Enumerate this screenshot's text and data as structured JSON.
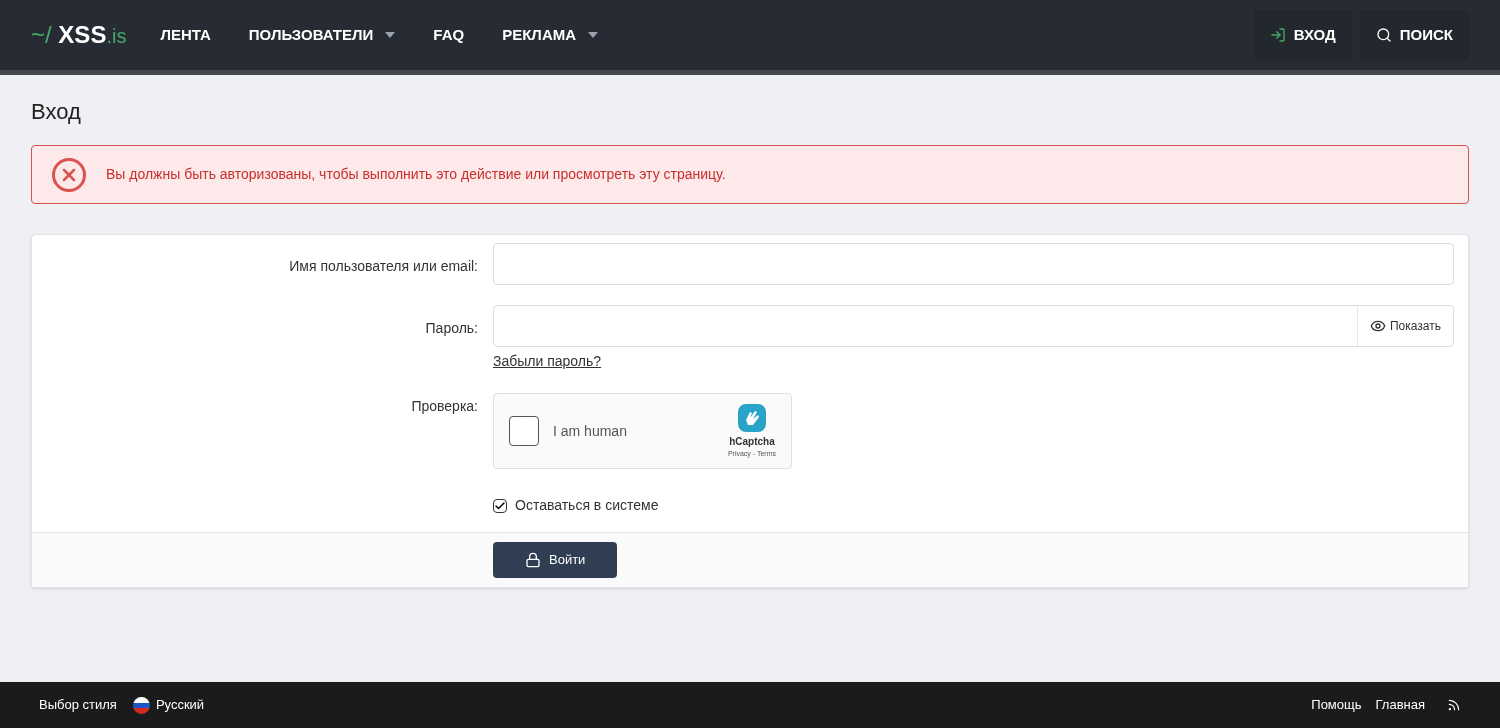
{
  "header": {
    "logo": {
      "prefix": "~/",
      "name": "XSS",
      "suffix": ".is"
    },
    "nav": [
      {
        "label": "ЛЕНТА",
        "dropdown": false
      },
      {
        "label": "ПОЛЬЗОВАТЕЛИ",
        "dropdown": true
      },
      {
        "label": "FAQ",
        "dropdown": false
      },
      {
        "label": "РЕКЛАМА",
        "dropdown": true
      }
    ],
    "actions": [
      {
        "kind": "login",
        "label": "ВХОД"
      },
      {
        "kind": "search",
        "label": "ПОИСК"
      }
    ]
  },
  "page_title": "Вход",
  "error": "Вы должны быть авторизованы, чтобы выполнить это действие или просмотреть эту страницу.",
  "form": {
    "username": {
      "label": "Имя пользователя или email:"
    },
    "password": {
      "label": "Пароль:",
      "show": "Показать",
      "forgot": "Забыли пароль?"
    },
    "captcha": {
      "label": "Проверка:",
      "text": "I am human",
      "checked": false,
      "brand": "hCaptcha",
      "links": "Privacy - Terms"
    },
    "remember": {
      "label": "Оставаться в системе",
      "checked": true
    },
    "submit": "Войти"
  },
  "footer": {
    "style": "Выбор стиля",
    "language": "Русский",
    "links": [
      "Помощь",
      "Главная"
    ]
  }
}
